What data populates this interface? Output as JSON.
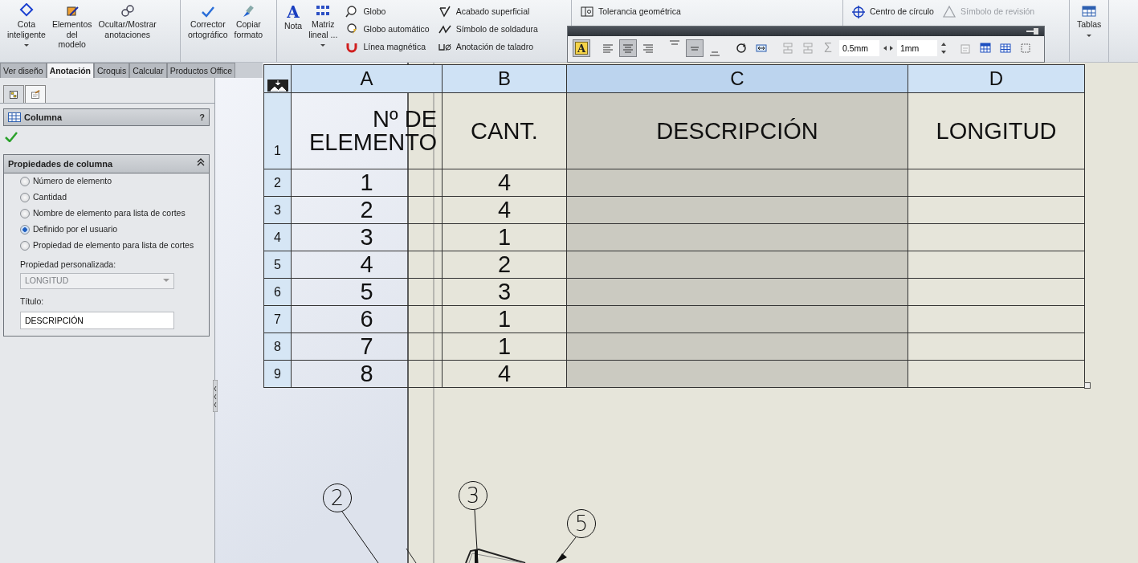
{
  "ribbon": {
    "groups": [
      {
        "items": [
          {
            "kind": "large",
            "label": "Cota\ninteligente",
            "dropdown": true
          },
          {
            "kind": "large",
            "label": "Elementos\ndel\nmodelo",
            "dropdown": false
          },
          {
            "kind": "large",
            "label": "Ocultar/Mostrar\nanotaciones",
            "dropdown": false
          }
        ]
      },
      {
        "items": [
          {
            "kind": "large",
            "label": "Corrector\nortográfico",
            "dropdown": false
          },
          {
            "kind": "large",
            "label": "Copiar\nformato",
            "dropdown": false
          }
        ]
      },
      {
        "items": [
          {
            "kind": "large",
            "label": "Nota",
            "glyph": "A",
            "dropdown": false
          },
          {
            "kind": "large",
            "label": "Matriz\nlineal ...",
            "dropdown": true
          },
          {
            "kind": "column",
            "entries": [
              {
                "label": "Globo",
                "disabled": false
              },
              {
                "label": "Globo automático",
                "disabled": false
              },
              {
                "label": "Línea magnética",
                "disabled": false
              }
            ]
          },
          {
            "kind": "column",
            "entries": [
              {
                "label": "Acabado superficial",
                "disabled": false
              },
              {
                "label": "Símbolo de soldadura",
                "disabled": false
              },
              {
                "label": "Anotación de taladro",
                "disabled": false
              }
            ]
          }
        ]
      },
      {
        "items": [
          {
            "kind": "column",
            "entries": [
              {
                "label": "Tolerancia geométrica",
                "disabled": false
              }
            ]
          }
        ]
      },
      {
        "items": [
          {
            "kind": "column",
            "entries": [
              {
                "label": "Centro de círculo",
                "disabled": false
              }
            ]
          },
          {
            "kind": "column",
            "entries": [
              {
                "label": "Símbolo de revisión",
                "disabled": true
              }
            ]
          }
        ]
      },
      {
        "items": [
          {
            "kind": "large",
            "label": "Tablas",
            "dropdown": true
          }
        ]
      }
    ]
  },
  "tabs": [
    {
      "label": "Ver diseño",
      "selected": false
    },
    {
      "label": "Anotación",
      "selected": true
    },
    {
      "label": "Croquis",
      "selected": false
    },
    {
      "label": "Calcular",
      "selected": false
    },
    {
      "label": "Productos Office",
      "selected": false
    }
  ],
  "format_toolbar": {
    "items": [
      {
        "kind": "font",
        "glyph": "A",
        "selected": true,
        "disabled": false
      },
      {
        "kind": "align-left",
        "selected": false,
        "disabled": false
      },
      {
        "kind": "align-center",
        "selected": true,
        "disabled": false
      },
      {
        "kind": "align-right",
        "selected": false,
        "disabled": false
      },
      {
        "kind": "valign-top",
        "selected": false,
        "disabled": false
      },
      {
        "kind": "valign-middle",
        "selected": true,
        "disabled": false
      },
      {
        "kind": "valign-bottom",
        "selected": false,
        "disabled": false
      },
      {
        "kind": "rotate",
        "selected": false,
        "disabled": false
      },
      {
        "kind": "fit",
        "selected": false,
        "disabled": false
      },
      {
        "kind": "insert-above",
        "selected": false,
        "disabled": true
      },
      {
        "kind": "insert-below",
        "selected": false,
        "disabled": true
      },
      {
        "kind": "sum",
        "glyph": "Σ",
        "selected": false,
        "disabled": true
      },
      {
        "kind": "field",
        "value": "0.5mm"
      },
      {
        "kind": "spinner-horizontal"
      },
      {
        "kind": "field",
        "value": "1mm"
      },
      {
        "kind": "spinner-vertical"
      },
      {
        "kind": "properties",
        "selected": false,
        "disabled": true
      },
      {
        "kind": "table-style",
        "selected": false,
        "disabled": false
      },
      {
        "kind": "table",
        "selected": false,
        "disabled": false
      },
      {
        "kind": "frame",
        "selected": false,
        "disabled": false
      }
    ]
  },
  "property_manager": {
    "panel_tabs": [
      {
        "selected": false
      },
      {
        "selected": true
      }
    ],
    "title": "Columna",
    "help": "?",
    "group": {
      "title": "Propiedades de columna",
      "expanded": true,
      "options": [
        {
          "label": "Número de elemento",
          "selected": false
        },
        {
          "label": "Cantidad",
          "selected": false
        },
        {
          "label": "Nombre de elemento para lista de cortes",
          "selected": false
        },
        {
          "label": "Definido por el usuario",
          "selected": true
        },
        {
          "label": "Propiedad de elemento para lista de cortes",
          "selected": false
        }
      ],
      "custom_property": {
        "label": "Propiedad personalizada:",
        "value": "LONGITUD",
        "disabled": true
      },
      "title_field": {
        "label": "Título:",
        "value": "DESCRIPCIÓN"
      }
    }
  },
  "table": {
    "columns": [
      {
        "letter": "A",
        "selected": false
      },
      {
        "letter": "B",
        "selected": false
      },
      {
        "letter": "C",
        "selected": true
      },
      {
        "letter": "D",
        "selected": false
      }
    ],
    "rows": [
      {
        "number": "1",
        "cells": [
          "Nº DE\nELEMENTO",
          "CANT.",
          "DESCRIPCIÓN",
          "LONGITUD"
        ]
      },
      {
        "number": "2",
        "cells": [
          "1",
          "4",
          "",
          ""
        ]
      },
      {
        "number": "3",
        "cells": [
          "2",
          "4",
          "",
          ""
        ]
      },
      {
        "number": "4",
        "cells": [
          "3",
          "1",
          "",
          ""
        ]
      },
      {
        "number": "5",
        "cells": [
          "4",
          "2",
          "",
          ""
        ]
      },
      {
        "number": "6",
        "cells": [
          "5",
          "3",
          "",
          ""
        ]
      },
      {
        "number": "7",
        "cells": [
          "6",
          "1",
          "",
          ""
        ]
      },
      {
        "number": "8",
        "cells": [
          "7",
          "1",
          "",
          ""
        ]
      },
      {
        "number": "9",
        "cells": [
          "8",
          "4",
          "",
          ""
        ]
      }
    ]
  },
  "drawing": {
    "balloons": [
      {
        "label": "2"
      },
      {
        "label": "3"
      },
      {
        "label": "5"
      }
    ]
  }
}
